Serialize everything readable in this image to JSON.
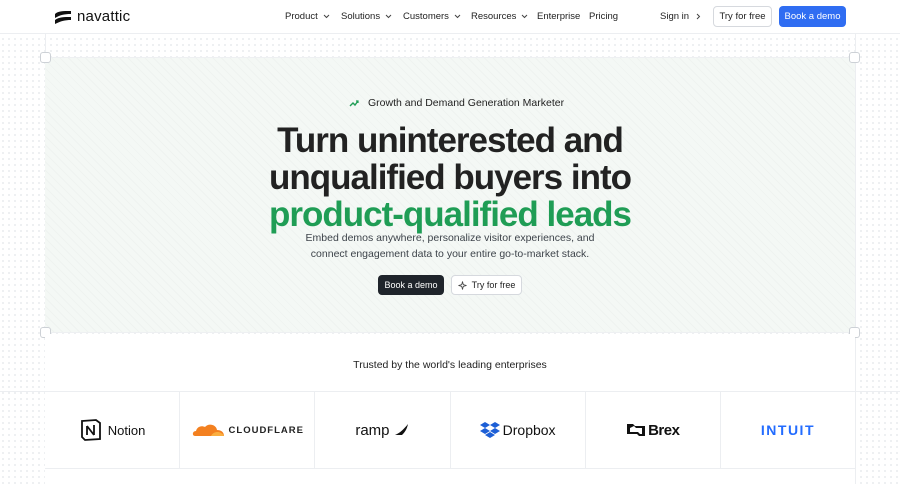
{
  "nav": {
    "brand": "navattic",
    "links": [
      {
        "label": "Product",
        "dropdown": true
      },
      {
        "label": "Solutions",
        "dropdown": true
      },
      {
        "label": "Customers",
        "dropdown": true
      },
      {
        "label": "Resources",
        "dropdown": true
      },
      {
        "label": "Enterprise",
        "dropdown": false
      },
      {
        "label": "Pricing",
        "dropdown": false
      }
    ],
    "sign_in": "Sign in",
    "try_free": "Try for free",
    "book_demo": "Book a demo"
  },
  "hero": {
    "badge": "Growth and Demand Generation Marketer",
    "headline_line1": "Turn uninterested and",
    "headline_line2": "unqualified buyers into",
    "headline_highlight": "product-qualified leads",
    "sub_line1": "Embed demos anywhere, personalize visitor experiences, and",
    "sub_line2": "connect engagement data to your entire go-to-market stack.",
    "cta_primary": "Book a demo",
    "cta_secondary": "Try for free"
  },
  "trusted": {
    "heading": "Trusted by the world's leading enterprises",
    "logos": [
      "Notion",
      "CLOUDFLARE",
      "ramp",
      "Dropbox",
      "Brex",
      "INTUIT"
    ]
  },
  "colors": {
    "accent_blue": "#2f6df2",
    "highlight_green": "#1f9d55",
    "dark_button": "#1f242b",
    "intuit_blue": "#236cff",
    "cloudflare_orange": "#f38020"
  }
}
